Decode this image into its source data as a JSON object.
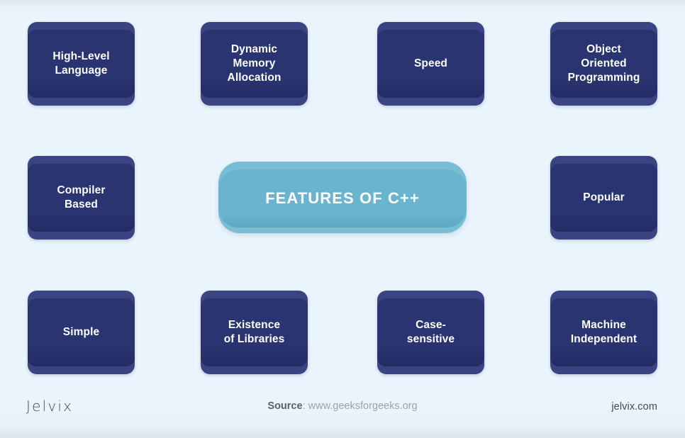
{
  "theme": {
    "background": "#eaf4fc",
    "card_shell": "#3b4482",
    "card_face": "#2a3470",
    "center_shell": "#79bdd4",
    "center_face": "#6bb4cf",
    "card_text": "#ffffff",
    "footer_text": "#3d4a59",
    "source_url_text": "#9aa3ad"
  },
  "center": {
    "title": "FEATURES OF C++"
  },
  "cards": [
    {
      "label": "High-Level\nLanguage",
      "row": 1,
      "col": 1
    },
    {
      "label": "Dynamic\nMemory\nAllocation",
      "row": 1,
      "col": 2
    },
    {
      "label": "Speed",
      "row": 1,
      "col": 3
    },
    {
      "label": "Object\nOriented\nProgramming",
      "row": 1,
      "col": 4
    },
    {
      "label": "Compiler\nBased",
      "row": 2,
      "col": 1
    },
    {
      "label": "Popular",
      "row": 2,
      "col": 4
    },
    {
      "label": "Simple",
      "row": 3,
      "col": 1
    },
    {
      "label": "Existence\nof Libraries",
      "row": 3,
      "col": 2
    },
    {
      "label": "Case-\nsensitive",
      "row": 3,
      "col": 3
    },
    {
      "label": "Machine\nIndependent",
      "row": 3,
      "col": 4
    }
  ],
  "footer": {
    "brand": "Jelvix",
    "source_label": "Source",
    "source_separator": ": ",
    "source_url": "www.geeksforgeeks.org",
    "site": "jelvix.com"
  }
}
